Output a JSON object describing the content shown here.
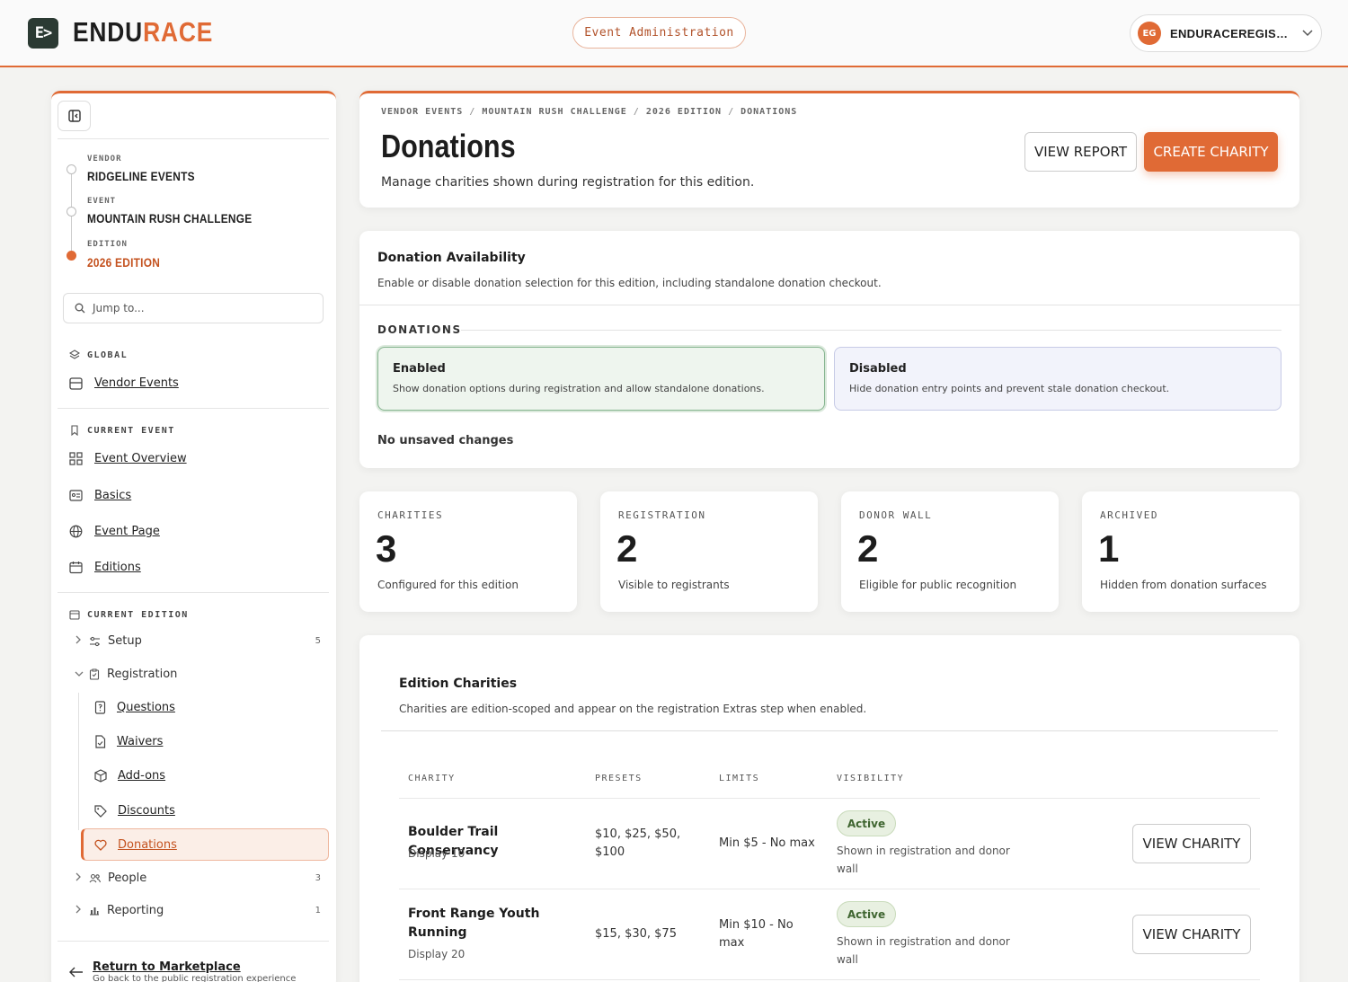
{
  "app": {
    "brand_part1": "ENDU",
    "brand_part2": "RACE",
    "logo_glyph": "E>",
    "admin_label": "Event Administration",
    "user_initials": "EG",
    "user_name": "ENDURACEREGISTRATION",
    "accent": "#e06a35"
  },
  "sidebar": {
    "vendor_kicker": "VENDOR",
    "vendor_value": "RIDGELINE EVENTS",
    "event_kicker": "EVENT",
    "event_value": "MOUNTAIN RUSH CHALLENGE",
    "edition_kicker": "EDITION",
    "edition_value": "2026 EDITION",
    "jump_placeholder": "Jump to...",
    "global_heading": "GLOBAL",
    "vendor_events": "Vendor Events",
    "current_event_heading": "CURRENT EVENT",
    "event_overview": "Event Overview",
    "basics": "Basics",
    "event_page": "Event Page",
    "editions": "Editions",
    "current_edition_heading": "CURRENT EDITION",
    "setup": "Setup",
    "setup_count": "5",
    "registration": "Registration",
    "questions": "Questions",
    "waivers": "Waivers",
    "addons": "Add-ons",
    "discounts": "Discounts",
    "donations": "Donations",
    "people": "People",
    "people_count": "3",
    "reporting": "Reporting",
    "reporting_count": "1",
    "return_title": "Return to Marketplace",
    "return_sub": "Go back to the public registration experience"
  },
  "header": {
    "breadcrumb": [
      "VENDOR EVENTS",
      "MOUNTAIN RUSH CHALLENGE",
      "2026 EDITION",
      "DONATIONS"
    ],
    "title": "Donations",
    "subtitle": "Manage charities shown during registration for this edition.",
    "view_report": "VIEW REPORT",
    "create_charity": "CREATE CHARITY"
  },
  "availability": {
    "title": "Donation Availability",
    "description": "Enable or disable donation selection for this edition, including standalone donation checkout.",
    "section_label": "DONATIONS",
    "enabled_title": "Enabled",
    "enabled_desc": "Show donation options during registration and allow standalone donations.",
    "disabled_title": "Disabled",
    "disabled_desc": "Hide donation entry points and prevent stale donation checkout.",
    "status": "No unsaved changes"
  },
  "stats": [
    {
      "label": "CHARITIES",
      "value": "3",
      "sub": "Configured for this edition"
    },
    {
      "label": "REGISTRATION",
      "value": "2",
      "sub": "Visible to registrants"
    },
    {
      "label": "DONOR WALL",
      "value": "2",
      "sub": "Eligible for public recognition"
    },
    {
      "label": "ARCHIVED",
      "value": "1",
      "sub": "Hidden from donation surfaces"
    }
  ],
  "charities": {
    "title": "Edition Charities",
    "description": "Charities are edition-scoped and appear on the registration Extras step when enabled.",
    "columns": [
      "CHARITY",
      "PRESETS",
      "LIMITS",
      "VISIBILITY"
    ],
    "rows": [
      {
        "name": "Boulder Trail Conservancy",
        "display": "Display 10",
        "presets": "$10, $25, $50, $100",
        "limits": "Min $5 - No max",
        "status": "Active",
        "visibility": "Shown in registration and donor wall",
        "action": "VIEW CHARITY"
      },
      {
        "name": "Front Range Youth Running",
        "display": "Display 20",
        "presets": "$15, $30, $75",
        "limits": "Min $10 - No max",
        "status": "Active",
        "visibility": "Shown in registration and donor wall",
        "action": "VIEW CHARITY"
      }
    ]
  }
}
